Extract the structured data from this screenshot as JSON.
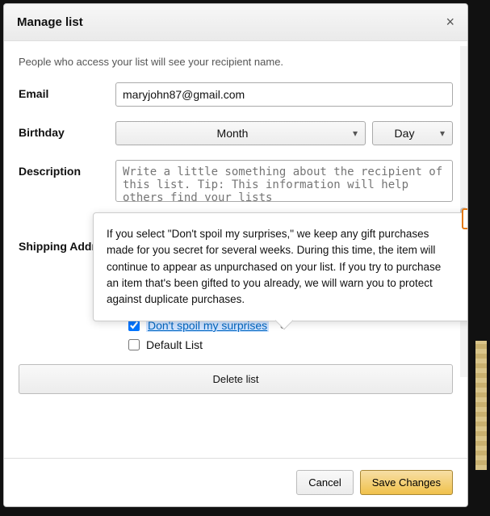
{
  "header": {
    "title": "Manage list"
  },
  "hint": "People who access your list will see your recipient name.",
  "fields": {
    "email": {
      "label": "Email",
      "value": "maryjohn87@gmail.com"
    },
    "birthday": {
      "label": "Birthday",
      "month": "Month",
      "day": "Day"
    },
    "description": {
      "label": "Description",
      "placeholder": "Write a little something about the recipient of this list. Tip: This information will help others find your lists"
    },
    "shipping": {
      "label": "Shipping Address"
    }
  },
  "checkboxes": {
    "dont_spoil": {
      "label": "Don't spoil my surprises",
      "checked": true
    },
    "default_list": {
      "label": "Default List",
      "checked": false
    }
  },
  "popover": {
    "text": "If you select \"Don't spoil my surprises,\" we keep any gift purchases made for you secret for several weeks. During this time, the item will continue to appear as unpurchased on your list. If you try to purchase an item that's been gifted to you already, we will warn you to protect against duplicate purchases."
  },
  "buttons": {
    "delete": "Delete list",
    "cancel": "Cancel",
    "save": "Save Changes"
  }
}
